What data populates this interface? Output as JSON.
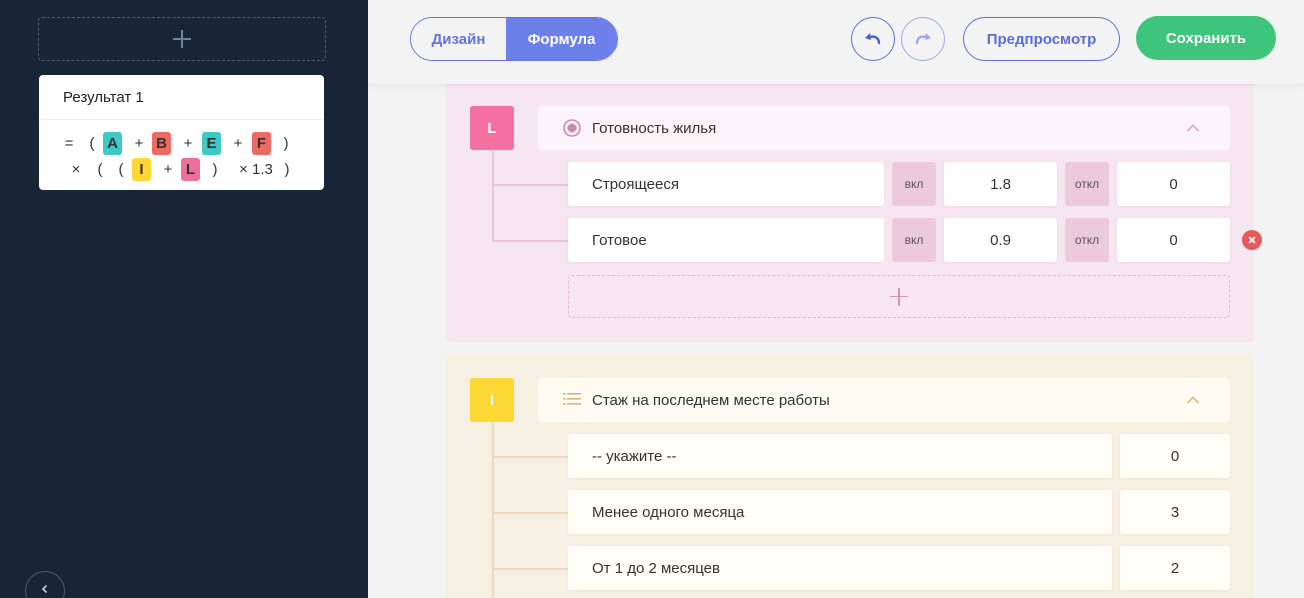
{
  "sidebar": {
    "result": {
      "title": "Результат 1",
      "formula_line1": [
        "=",
        "(",
        "A",
        "+",
        "B",
        "+",
        "E",
        "+",
        "F",
        ")"
      ],
      "formula_line2": [
        "×",
        "(",
        "(",
        "I",
        "+",
        "L",
        ")",
        "× 1.3",
        ")"
      ]
    },
    "collapse_icon": "chevron-left-icon"
  },
  "toolbar": {
    "design_label": "Дизайн",
    "formula_label": "Формула",
    "preview_label": "Предпросмотр",
    "save_label": "Сохранить",
    "undo_icon": "undo-icon",
    "redo_icon": "redo-icon"
  },
  "colors": {
    "sidebar_bg": "#182536",
    "accent": "#6c80ea",
    "save": "#3ec47b",
    "var_teal": "#3ec9c4",
    "var_red": "#ee6b63",
    "var_yellow": "#ffd535",
    "var_pink": "#f06e9c"
  },
  "block_l": {
    "letter": "L",
    "icon": "radio-icon",
    "title": "Готовность жилья",
    "rows": [
      {
        "label": "Строящееся",
        "on_label": "вкл",
        "on_value": "1.8",
        "off_label": "откл",
        "off_value": "0"
      },
      {
        "label": "Готовое",
        "on_label": "вкл",
        "on_value": "0.9",
        "off_label": "откл",
        "off_value": "0"
      }
    ]
  },
  "block_i": {
    "letter": "I",
    "icon": "list-icon",
    "title": "Стаж на последнем месте работы",
    "rows": [
      {
        "label": "-- укажите --",
        "value": "0"
      },
      {
        "label": "Менее одного месяца",
        "value": "3"
      },
      {
        "label": "От 1 до 2 месяцев",
        "value": "2"
      }
    ]
  }
}
